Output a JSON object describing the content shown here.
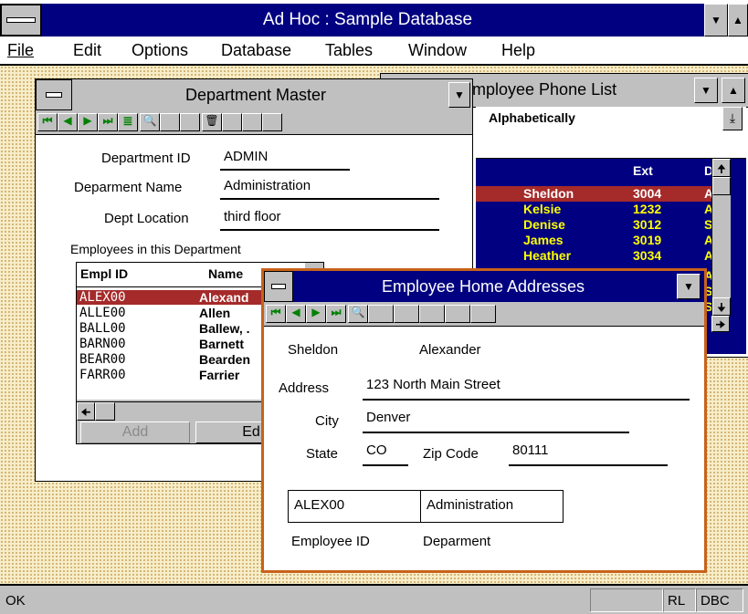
{
  "app_title": "Ad Hoc : Sample Database",
  "menu": [
    {
      "label": "File"
    },
    {
      "label": "Edit"
    },
    {
      "label": "Options"
    },
    {
      "label": "Database"
    },
    {
      "label": "Tables"
    },
    {
      "label": "Window"
    },
    {
      "label": "Help"
    }
  ],
  "phone_list": {
    "title": "mployee Phone List",
    "sort_select": "Alphabetically",
    "col_ext": "Ext",
    "col_dept": "D",
    "rows": [
      {
        "name": "Sheldon",
        "ext": "3004",
        "d": "A"
      },
      {
        "name": "Kelsie",
        "ext": "1232",
        "d": "A"
      },
      {
        "name": "Denise",
        "ext": "3012",
        "d": "S"
      },
      {
        "name": "James",
        "ext": "3019",
        "d": "A"
      },
      {
        "name": "Heather",
        "ext": "3034",
        "d": "A"
      }
    ],
    "extra_d": [
      "A",
      "S",
      "S"
    ]
  },
  "dept": {
    "title": "Department Master",
    "id_label": "Department ID",
    "id_value": "ADMIN",
    "name_label": "Deparment Name",
    "name_value": "Administration",
    "loc_label": "Dept Location",
    "loc_value": "third floor",
    "emp_header": "Employees in this Department",
    "col_id": "Empl ID",
    "col_name": "Name",
    "rows": [
      {
        "id": "ALEX00",
        "name": "Alexand"
      },
      {
        "id": "ALLE00",
        "name": "Allen"
      },
      {
        "id": "BALL00",
        "name": "Ballew, ."
      },
      {
        "id": "BARN00",
        "name": "Barnett"
      },
      {
        "id": "BEAR00",
        "name": "Bearden"
      },
      {
        "id": "FARR00",
        "name": "Farrier"
      }
    ],
    "add_button": "Add",
    "edit_button": "Ed"
  },
  "home": {
    "title": "Employee Home Addresses",
    "first": "Sheldon",
    "last": "Alexander",
    "address_label": "Address",
    "address_value": "123 North Main Street",
    "city_label": "City",
    "city_value": "Denver",
    "state_label": "State",
    "state_value": "CO",
    "zip_label": "Zip Code",
    "zip_value": "80111",
    "emp_id_box": "ALEX00",
    "dept_box": "Administration",
    "emp_id_label": "Employee ID",
    "dept_label": "Deparment"
  },
  "status": {
    "left": "OK",
    "rl": "RL",
    "dbc": "DBC"
  },
  "colors": {
    "title_active": "#000080",
    "selected_row": "#a52a2a",
    "window_frame": "#c8621a",
    "list_bg": "#000080",
    "list_text": "#ffff00"
  }
}
